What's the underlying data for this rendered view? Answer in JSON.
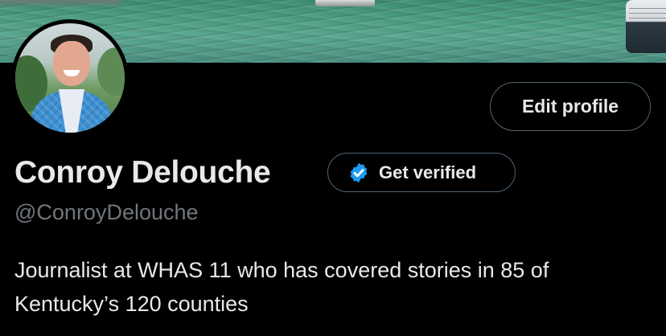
{
  "profile": {
    "display_name": "Conroy Delouche",
    "handle": "@ConroyDelouche",
    "bio_line1": "Journalist at WHAS 11 who has covered stories in 85 of",
    "bio_line2": "Kentucky’s 120 counties"
  },
  "actions": {
    "edit_profile_label": "Edit profile",
    "get_verified_label": "Get verified"
  },
  "icons": {
    "verified_badge": "verified-badge-icon"
  },
  "colors": {
    "background": "#000000",
    "text_primary": "#e7e9ea",
    "text_secondary": "#71767b",
    "border": "#536471",
    "verified_blue": "#1d9bf0"
  }
}
